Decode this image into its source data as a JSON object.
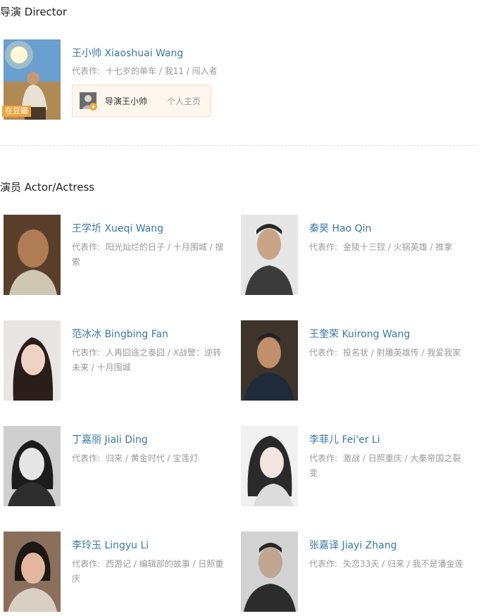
{
  "director_section": {
    "title": "导演 Director",
    "director": {
      "name": "王小帅 Xiaoshuai Wang",
      "works_label": "代表作:",
      "works": "十七岁的单车 / 我11 / 闯入者",
      "badge": "在豆瓣",
      "profile_name": "导演王小帅",
      "profile_link": "个人主页"
    }
  },
  "actor_section": {
    "title": "演员 Actor/Actress",
    "works_label": "代表作:",
    "actors": [
      {
        "name": "王学圻 Xueqi Wang",
        "works_line1": "阳光灿烂的日子 / 十月围城 / 搜",
        "works_line2": "索"
      },
      {
        "name": "秦昊 Hao Qin",
        "works_line1": "金陵十三钗 / 火锅英雄 / 推拿",
        "works_line2": ""
      },
      {
        "name": "范冰冰 Bingbing Fan",
        "works_line1": "人再囧途之泰囧 / X战警：逆转",
        "works_line2": "未来 / 十月围城"
      },
      {
        "name": "王奎荣 Kuirong Wang",
        "works_line1": "投名状 / 射雕英雄传 / 我爱我家",
        "works_line2": ""
      },
      {
        "name": "丁嘉丽 Jiali Ding",
        "works_line1": "归来 / 黄金时代 / 宝莲灯",
        "works_line2": ""
      },
      {
        "name": "李菲儿 Fei'er Li",
        "works_line1": "激战 / 日照重庆 / 大秦帝国之裂",
        "works_line2": "变"
      },
      {
        "name": "李玲玉 Lingyu Li",
        "works_line1": "西游记 / 编辑部的故事 / 日照重",
        "works_line2": "庆"
      },
      {
        "name": "张嘉译 Jiayi Zhang",
        "works_line1": "失恋33天 / 归来 / 我不是潘金莲",
        "works_line2": ""
      }
    ]
  }
}
